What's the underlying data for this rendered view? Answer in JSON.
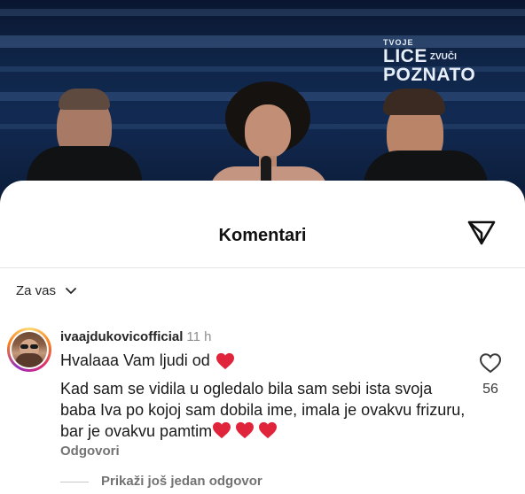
{
  "video": {
    "logo_line1": "TVOJE",
    "logo_line2": "LICE",
    "logo_line2b": "ZVUČI",
    "logo_line3": "POZNATO"
  },
  "sheet": {
    "title": "Komentari",
    "share_icon": "send-icon"
  },
  "filter": {
    "label": "Za vas",
    "icon": "chevron-down-icon"
  },
  "comment": {
    "username": "ivaajdukovicofficial",
    "time": "11 h",
    "line1": "Hvalaaa Vam ljudi od",
    "body": "Kad sam se vidila u ogledalo bila sam sebi ista svoja baba Iva po kojoj sam dobila ime, imala je ovakvu frizuru, bar je ovakvu pamtim",
    "reply_label": "Odgovori",
    "like_count": "56",
    "heart_color": "#e0243c"
  },
  "more_replies": {
    "label": "Prikaži još jedan odgovor"
  }
}
